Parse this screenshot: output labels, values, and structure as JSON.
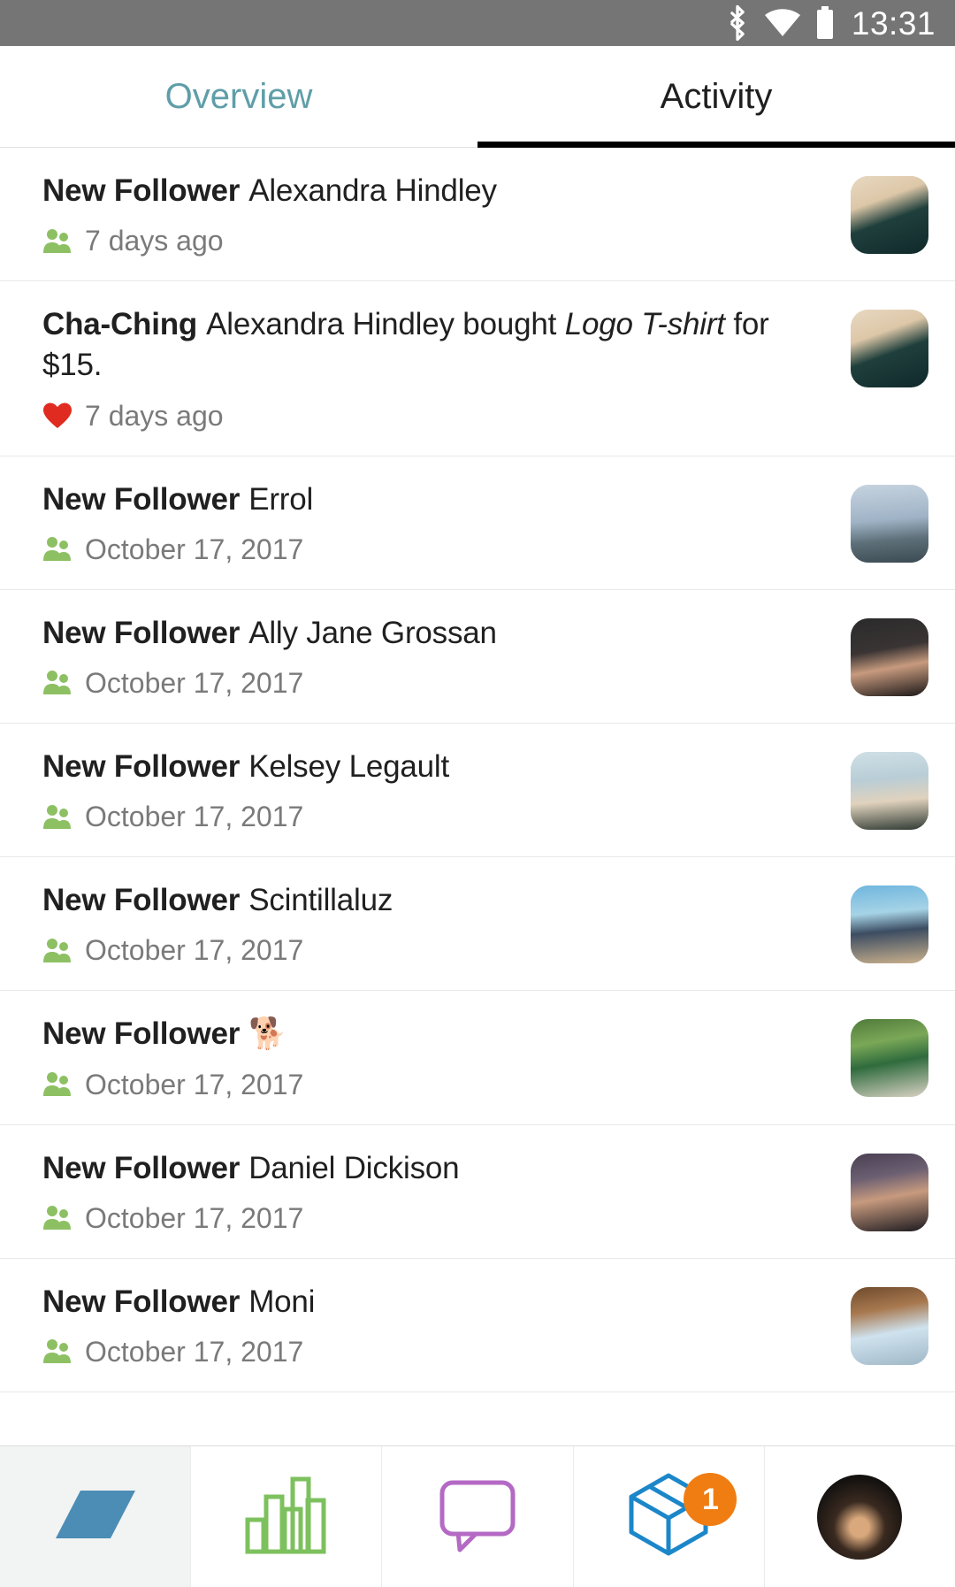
{
  "statusbar": {
    "time": "13:31",
    "icons": [
      "bluetooth-icon",
      "wifi-icon",
      "battery-icon"
    ]
  },
  "tabs": [
    {
      "label": "Overview",
      "active": false
    },
    {
      "label": "Activity",
      "active": true
    }
  ],
  "colors": {
    "tab_inactive": "#5f9ea8",
    "tab_active": "#1f1f1f",
    "follower_icon": "#8dc063",
    "sale_icon": "#e02b20",
    "badge": "#f07d12",
    "statusbar": "#757575",
    "nav_selected_bg": "#f2f3f3",
    "nav_shop_icon": "#4b8db5",
    "nav_stats_icon": "#7dc15e",
    "nav_messages_icon": "#b469c4",
    "nav_orders_icon": "#1b87c9"
  },
  "activity": {
    "items": [
      {
        "kind": "New Follower",
        "subject": "Alexandra Hindley",
        "detail": "",
        "italic": "",
        "tail": "",
        "timestamp": "7 days ago",
        "icon": "followers-icon"
      },
      {
        "kind": "Cha-Ching",
        "subject": "Alexandra Hindley bought ",
        "detail": "",
        "italic": "Logo T-shirt",
        "tail": " for $15.",
        "timestamp": "7 days ago",
        "icon": "heart-icon"
      },
      {
        "kind": "New Follower",
        "subject": "Errol",
        "detail": "",
        "italic": "",
        "tail": "",
        "timestamp": "October 17, 2017",
        "icon": "followers-icon"
      },
      {
        "kind": "New Follower",
        "subject": "Ally Jane Grossan",
        "detail": "",
        "italic": "",
        "tail": "",
        "timestamp": "October 17, 2017",
        "icon": "followers-icon"
      },
      {
        "kind": "New Follower",
        "subject": "Kelsey Legault",
        "detail": "",
        "italic": "",
        "tail": "",
        "timestamp": "October 17, 2017",
        "icon": "followers-icon"
      },
      {
        "kind": "New Follower",
        "subject": "Scintillaluz",
        "detail": "",
        "italic": "",
        "tail": "",
        "timestamp": "October 17, 2017",
        "icon": "followers-icon"
      },
      {
        "kind": "New Follower",
        "subject": "🐕",
        "detail": "",
        "italic": "",
        "tail": "",
        "timestamp": "October 17, 2017",
        "icon": "followers-icon"
      },
      {
        "kind": "New Follower",
        "subject": "Daniel Dickison",
        "detail": "",
        "italic": "",
        "tail": "",
        "timestamp": "October 17, 2017",
        "icon": "followers-icon"
      },
      {
        "kind": "New Follower",
        "subject": "Moni",
        "detail": "",
        "italic": "",
        "tail": "",
        "timestamp": "October 17, 2017",
        "icon": "followers-icon"
      }
    ]
  },
  "bottomnav": {
    "items": [
      {
        "name": "shop-tab",
        "icon": "parallelogram-shop-icon",
        "selected": true,
        "badge": ""
      },
      {
        "name": "stats-tab",
        "icon": "bar-chart-icon",
        "selected": false,
        "badge": ""
      },
      {
        "name": "messages-tab",
        "icon": "speech-bubble-icon",
        "selected": false,
        "badge": ""
      },
      {
        "name": "orders-tab",
        "icon": "package-box-icon",
        "selected": false,
        "badge": "1"
      },
      {
        "name": "account-tab",
        "icon": "user-avatar-icon",
        "selected": false,
        "badge": ""
      }
    ]
  }
}
